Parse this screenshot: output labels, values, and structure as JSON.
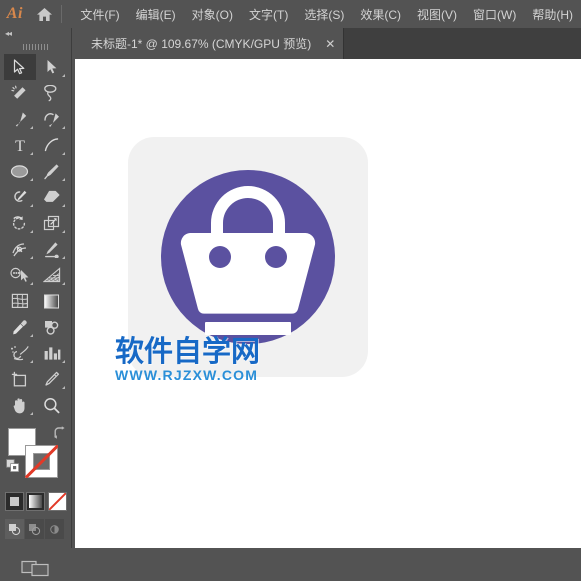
{
  "app": {
    "logo_text": "Ai",
    "home_icon": "home-icon"
  },
  "menubar": {
    "items": [
      {
        "label": "文件(F)",
        "name": "menu-file"
      },
      {
        "label": "编辑(E)",
        "name": "menu-edit"
      },
      {
        "label": "对象(O)",
        "name": "menu-object"
      },
      {
        "label": "文字(T)",
        "name": "menu-type"
      },
      {
        "label": "选择(S)",
        "name": "menu-select"
      },
      {
        "label": "效果(C)",
        "name": "menu-effect"
      },
      {
        "label": "视图(V)",
        "name": "menu-view"
      },
      {
        "label": "窗口(W)",
        "name": "menu-window"
      },
      {
        "label": "帮助(H)",
        "name": "menu-help"
      }
    ]
  },
  "tabbar": {
    "tabs": [
      {
        "title": "未标题-1* @ 109.67% (CMYK/GPU 预览)",
        "close_label": "✕",
        "active": true
      }
    ]
  },
  "toolpanel": {
    "collapse_icon": "◂◂",
    "tools": [
      {
        "name": "selection-tool",
        "tip": "选择工具",
        "active": true,
        "corner": false
      },
      {
        "name": "direct-selection-tool",
        "tip": "直接选择工具",
        "active": false,
        "corner": true
      },
      {
        "name": "magic-wand-tool",
        "tip": "魔棒工具",
        "active": false,
        "corner": false
      },
      {
        "name": "lasso-tool",
        "tip": "套索工具",
        "active": false,
        "corner": false
      },
      {
        "name": "pen-tool",
        "tip": "钢笔工具",
        "active": false,
        "corner": true
      },
      {
        "name": "curvature-tool",
        "tip": "曲率工具",
        "active": false,
        "corner": true
      },
      {
        "name": "type-tool",
        "tip": "文字工具",
        "active": false,
        "corner": true
      },
      {
        "name": "line-segment-tool",
        "tip": "直线段工具",
        "active": false,
        "corner": true
      },
      {
        "name": "ellipse-tool",
        "tip": "椭圆工具",
        "active": false,
        "corner": true
      },
      {
        "name": "paintbrush-tool",
        "tip": "画笔工具",
        "active": false,
        "corner": true
      },
      {
        "name": "shaper-pencil-tool",
        "tip": "Shaper 工具",
        "active": false,
        "corner": true
      },
      {
        "name": "eraser-tool",
        "tip": "橡皮擦工具",
        "active": false,
        "corner": true
      },
      {
        "name": "rotate-tool",
        "tip": "旋转工具",
        "active": false,
        "corner": true
      },
      {
        "name": "scale-tool",
        "tip": "比例缩放工具",
        "active": false,
        "corner": true
      },
      {
        "name": "width-tool",
        "tip": "宽度工具",
        "active": false,
        "corner": true
      },
      {
        "name": "free-transform-tool",
        "tip": "自由变换工具",
        "active": false,
        "corner": true
      },
      {
        "name": "shape-builder-tool",
        "tip": "形状生成器工具",
        "active": false,
        "corner": true
      },
      {
        "name": "perspective-grid-tool",
        "tip": "透视网格工具",
        "active": false,
        "corner": true
      },
      {
        "name": "mesh-tool",
        "tip": "网格工具",
        "active": false,
        "corner": false
      },
      {
        "name": "gradient-tool",
        "tip": "渐变工具",
        "active": false,
        "corner": false
      },
      {
        "name": "eyedropper-tool",
        "tip": "吸管工具",
        "active": false,
        "corner": true
      },
      {
        "name": "blend-tool",
        "tip": "混合工具",
        "active": false,
        "corner": false
      },
      {
        "name": "symbol-sprayer-tool",
        "tip": "符号喷枪工具",
        "active": false,
        "corner": true
      },
      {
        "name": "column-graph-tool",
        "tip": "柱形图工具",
        "active": false,
        "corner": true
      },
      {
        "name": "artboard-tool",
        "tip": "画板工具",
        "active": false,
        "corner": false
      },
      {
        "name": "slice-tool",
        "tip": "切片工具",
        "active": false,
        "corner": true
      },
      {
        "name": "hand-tool",
        "tip": "抓手工具",
        "active": false,
        "corner": true
      },
      {
        "name": "zoom-tool",
        "tip": "缩放工具",
        "active": false,
        "corner": false
      }
    ],
    "color_controls": {
      "fill_color": "#ffffff",
      "stroke_color": "none",
      "swap_icon": "swap-fill-stroke-icon",
      "default_icon": "default-fill-stroke-icon",
      "modes": [
        {
          "name": "color-mode-button",
          "label": "颜色",
          "active": false
        },
        {
          "name": "gradient-mode-button",
          "label": "渐变",
          "active": false
        },
        {
          "name": "none-mode-button",
          "label": "无",
          "active": true
        }
      ],
      "draw_modes": [
        {
          "name": "draw-normal-button",
          "label": "正常绘图",
          "active": true
        },
        {
          "name": "draw-behind-button",
          "label": "背面绘图",
          "active": false
        },
        {
          "name": "draw-inside-button",
          "label": "内部绘图",
          "active": false
        }
      ],
      "screen_mode": {
        "name": "change-screen-mode-button",
        "label": "更改屏幕模式"
      }
    }
  },
  "canvas": {
    "background": "#ffffff",
    "artwork": {
      "name": "shopping-basket-icon",
      "plate_color": "#f1f1f1",
      "circle_color": "#5b51a0",
      "basket_color": "#ffffff",
      "corner_radius": 26
    },
    "watermark": {
      "line1": "软件自学网",
      "line2": "WWW.RJZXW.COM",
      "color1": "#1769c6",
      "color2": "#2a8fd8"
    }
  }
}
